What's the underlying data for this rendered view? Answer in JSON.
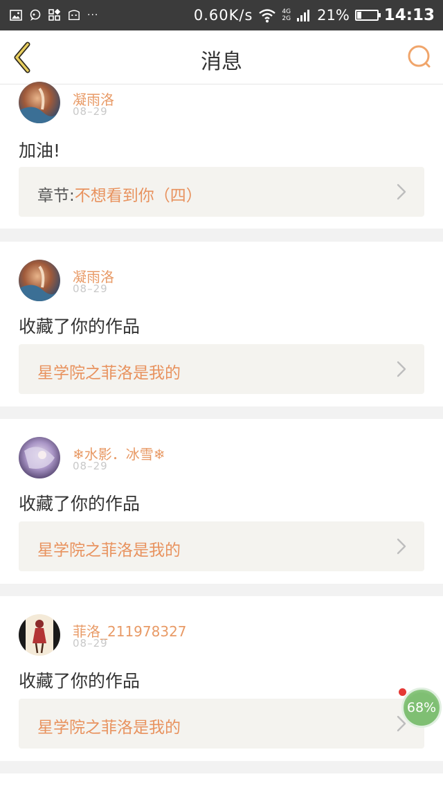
{
  "status_bar": {
    "speed": "0.60K/s",
    "network_top": "4G",
    "network_bottom": "2G",
    "battery_pct": "21%",
    "battery_level": 0.21,
    "time": "14:13",
    "icons": [
      "image-icon",
      "chat-icon",
      "grid-icon",
      "face-icon",
      "more-dots-icon",
      "wifi-icon",
      "signal-icon",
      "battery-icon"
    ]
  },
  "header": {
    "title": "消息",
    "back_icon": "chevron-left-icon",
    "search_icon": "search-icon",
    "accent_color": "#e8925e"
  },
  "messages": [
    {
      "username": "凝雨洛",
      "date": "08–29",
      "text": "加油!",
      "link_prefix": "章节:",
      "link_text": "不想看到你（四）"
    },
    {
      "username": "凝雨洛",
      "date": "08–29",
      "text": "收藏了你的作品",
      "link_prefix": "",
      "link_text": "星学院之菲洛是我的"
    },
    {
      "username": "❄水影．冰雪❄",
      "date": "08–29",
      "text": "收藏了你的作品",
      "link_prefix": "",
      "link_text": "星学院之菲洛是我的"
    },
    {
      "username": "菲洛_211978327",
      "date": "08–29",
      "text": "收藏了你的作品",
      "link_prefix": "",
      "link_text": "星学院之菲洛是我的"
    }
  ],
  "floating_ball": {
    "label": "68%",
    "value": 0.68
  }
}
